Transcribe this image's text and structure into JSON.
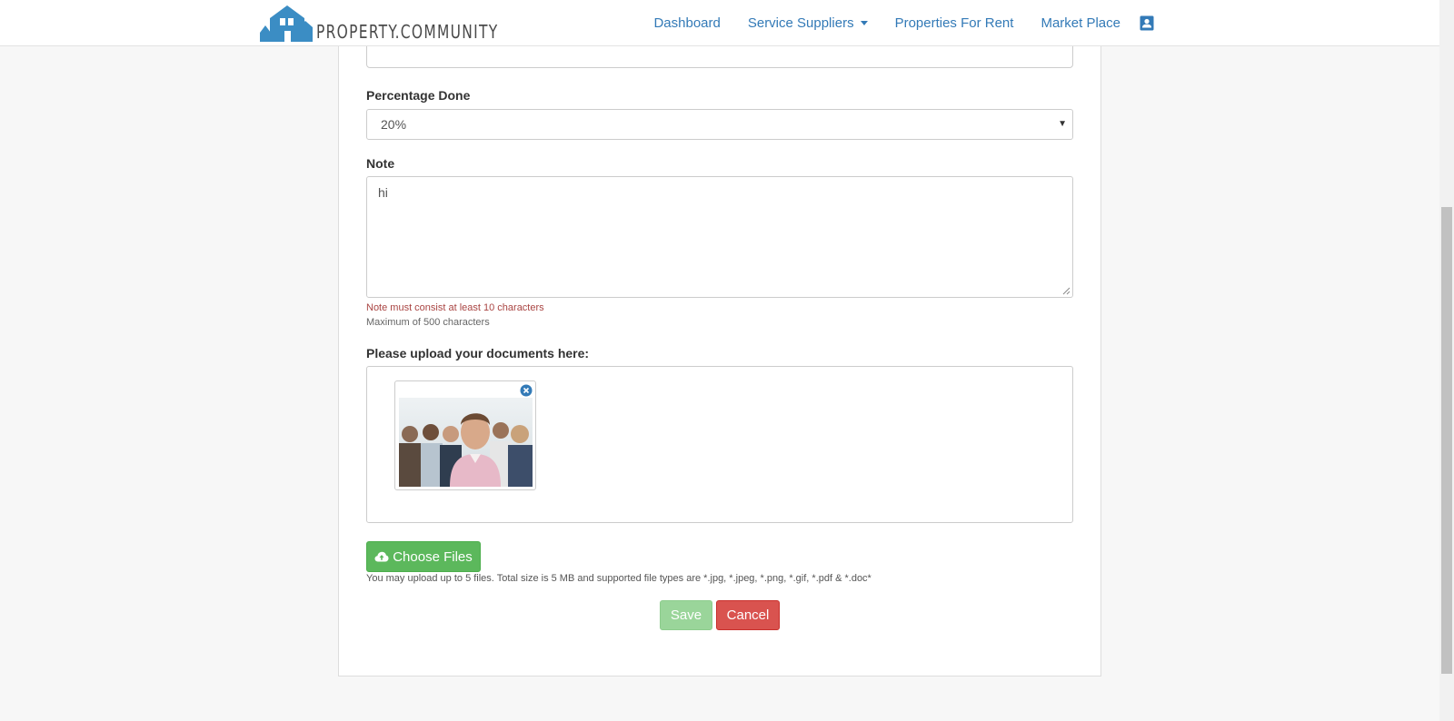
{
  "brand": {
    "name": "PROPERTY.COMMUNITY",
    "logo_icon": "houses-logo-icon"
  },
  "nav": {
    "items": [
      {
        "label": "Dashboard"
      },
      {
        "label": "Service Suppliers",
        "has_dropdown": true
      },
      {
        "label": "Properties For Rent"
      },
      {
        "label": "Market Place"
      }
    ],
    "profile_icon": "contact-card-icon"
  },
  "form": {
    "percentage": {
      "label": "Percentage Done",
      "value": "20%"
    },
    "note": {
      "label": "Note",
      "value": "hi",
      "error": "Note must consist at least 10 characters",
      "help": "Maximum of 500 characters"
    },
    "upload": {
      "label": "Please upload your documents here:",
      "choose_label": "Choose Files",
      "note": "You may upload up to 5 files. Total size is 5 MB and supported file types are *.jpg, *.jpeg, *.png, *.gif, *.pdf & *.doc*",
      "files": [
        {
          "kind": "image",
          "remove_icon": "remove-circle-icon"
        }
      ]
    },
    "actions": {
      "save_label": "Save",
      "cancel_label": "Cancel"
    }
  },
  "colors": {
    "link": "#337ab7",
    "success": "#5cb85c",
    "success_disabled": "#9ad59a",
    "danger": "#d9534f",
    "error_text": "#a94442"
  }
}
